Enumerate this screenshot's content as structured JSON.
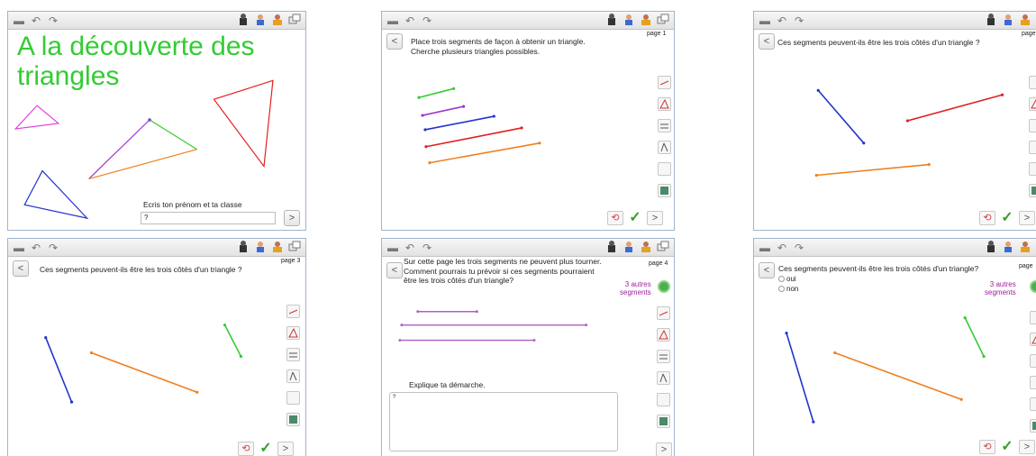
{
  "panels": [
    {
      "id": "p1",
      "title": "A la découverte des triangles",
      "prompt": "Ecris ton prénom et ta classe",
      "input_value": "?",
      "next_label": ">"
    },
    {
      "id": "p2",
      "page_label": "page 1",
      "question": "Place trois segments de façon à obtenir un triangle.\nCherche plusieurs triangles possibles.",
      "back_label": "<",
      "next_label": ">"
    },
    {
      "id": "p3",
      "page_label": "page",
      "question": "Ces segments peuvent-ils être les trois côtés d'un triangle ?",
      "back_label": "<",
      "next_label": ">"
    },
    {
      "id": "p4",
      "page_label": "page 3",
      "question": "Ces segments peuvent-ils être les trois côtés d'un triangle ?",
      "back_label": "<",
      "next_label": ">"
    },
    {
      "id": "p5",
      "page_label": "page 4",
      "question": "Sur cette page les trois segments ne peuvent plus tourner.\nComment pourrais tu prévoir si ces segments pourraient\nêtre les trois côtés d'un triangle?",
      "extra_segments": "3 autres\nsegments",
      "explain_label": "Explique ta démarche.",
      "explain_value": "?",
      "back_label": "<",
      "next_label": ">"
    },
    {
      "id": "p6",
      "page_label": "page",
      "question": "Ces segments peuvent-ils être les trois côtés d'un triangle?",
      "options": [
        "oui",
        "non"
      ],
      "extra_segments": "3 autres\nsegments",
      "back_label": "<",
      "next_label": ">"
    }
  ],
  "icons": {
    "tools": [
      "segment-tool-icon",
      "triangle-tool-icon",
      "measure-tool-icon",
      "compass-tool-icon",
      "blank-tool-icon",
      "calculator-icon"
    ],
    "roles": [
      "student-icon",
      "teacher-icon",
      "parent-icon",
      "windows-icon"
    ]
  },
  "colors": {
    "green": "#33cc33",
    "purple": "#9933cc",
    "blue": "#2233cc",
    "red": "#e02020",
    "orange": "#f08020",
    "magenta": "#e040e0",
    "border": "#9fb6cf"
  }
}
